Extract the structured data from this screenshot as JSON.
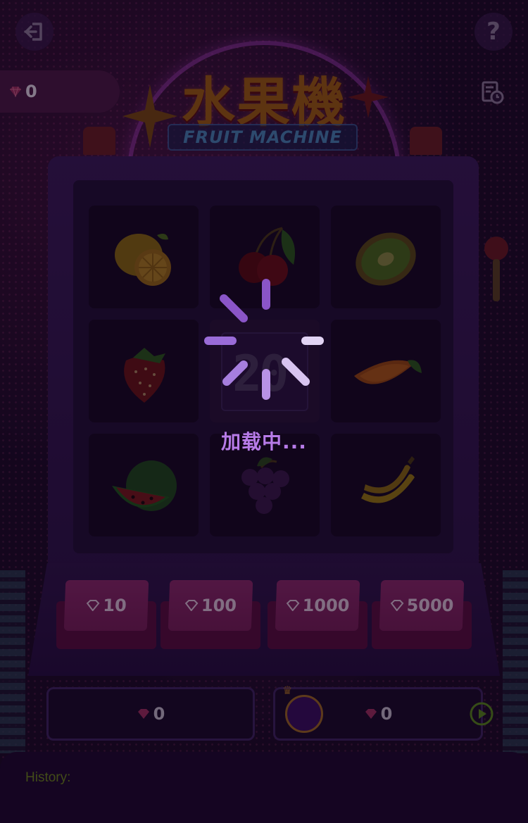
{
  "header": {
    "balance_value": "0",
    "logo_cn": "水果機",
    "logo_en": "FRUIT MACHINE"
  },
  "icons": {
    "exit": "exit-icon",
    "help": "?",
    "history": "history-icon",
    "gem": "gem-icon"
  },
  "reels": [
    [
      "lemon",
      "cherry",
      "kiwi"
    ],
    [
      "strawberry",
      "digital-display",
      "orange"
    ],
    [
      "watermelon",
      "grapes",
      "banana"
    ]
  ],
  "bets": [
    {
      "label": "10"
    },
    {
      "label": "100"
    },
    {
      "label": "1000"
    },
    {
      "label": "5000"
    }
  ],
  "panels": {
    "left_value": "0",
    "right_value": "0"
  },
  "history": {
    "label": "History:"
  },
  "loading": {
    "digits": "20",
    "text": "加载中..."
  },
  "colors": {
    "background": "#1c0c26",
    "loading_text": "#b77be8",
    "history_label": "#6f8a1c",
    "bet_button": "#7a2059"
  }
}
